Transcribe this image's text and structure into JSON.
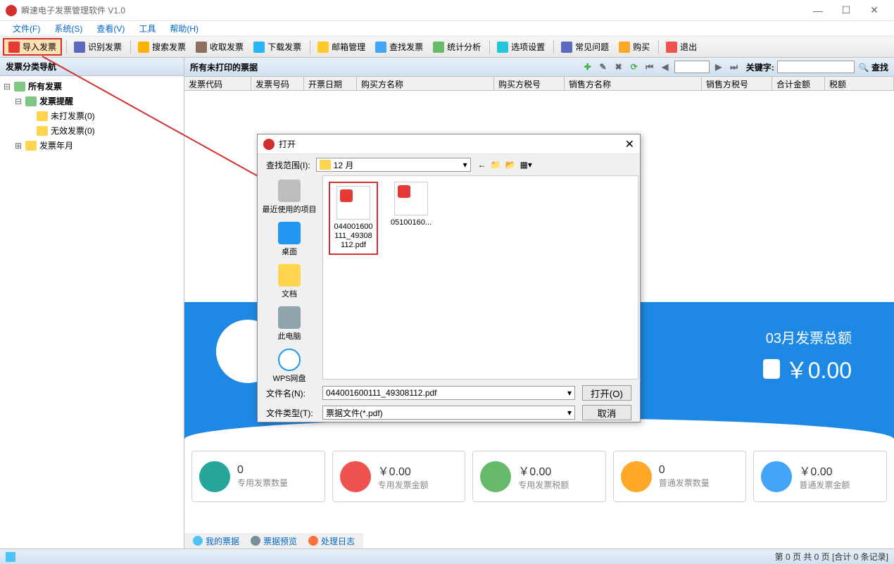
{
  "titlebar": {
    "title": "瞬速电子发票管理软件 V1.0"
  },
  "menubar": {
    "file": "文件(F)",
    "system": "系统(S)",
    "view": "查看(V)",
    "tools": "工具",
    "help": "帮助(H)"
  },
  "toolbar": {
    "import": "导入发票",
    "recognize": "识别发票",
    "search": "搜索发票",
    "receive": "收取发票",
    "download": "下载发票",
    "mailbox": "邮箱管理",
    "find": "查找发票",
    "stats": "统计分析",
    "options": "选项设置",
    "faq": "常见问题",
    "buy": "购买",
    "exit": "退出"
  },
  "sidebar": {
    "header": "发票分类导航",
    "nodes": {
      "all": "所有发票",
      "remind": "发票提醒",
      "unprinted": "未打发票(0)",
      "invalid": "无效发票(0)",
      "byyear": "发票年月"
    }
  },
  "content": {
    "header": "所有未打印的票据",
    "keyword_label": "关键字:",
    "search_btn": "查找",
    "columns": {
      "code": "发票代码",
      "number": "发票号码",
      "date": "开票日期",
      "buyer": "购买方名称",
      "buyer_tax": "购买方税号",
      "seller": "销售方名称",
      "seller_tax": "销售方税号",
      "total": "合计金额",
      "tax": "税额"
    }
  },
  "dialog": {
    "title": "打开",
    "range_label": "查找范围(I):",
    "folder": "12 月",
    "sidebar": {
      "recent": "最近使用的项目",
      "desktop": "桌面",
      "docs": "文档",
      "pc": "此电脑",
      "wps": "WPS网盘"
    },
    "files": {
      "f1": "044001600111_49308112.pdf",
      "f2": "05100160..."
    },
    "filename_label": "文件名(N):",
    "filename_value": "044001600111_49308112.pdf",
    "filetype_label": "文件类型(T):",
    "filetype_value": "票据文件(*.pdf)",
    "open_btn": "打开(O)",
    "cancel_btn": "取消"
  },
  "dashboard": {
    "month_label": "03月发票总额",
    "month_amount": "￥0.00",
    "cards": [
      {
        "value": "0",
        "label": "专用发票数量"
      },
      {
        "value": "￥0.00",
        "label": "专用发票金额"
      },
      {
        "value": "￥0.00",
        "label": "专用发票税额"
      },
      {
        "value": "0",
        "label": "普通发票数量"
      },
      {
        "value": "￥0.00",
        "label": "普通发票金额"
      }
    ]
  },
  "bottom_tabs": {
    "my": "我的票据",
    "preview": "票据预览",
    "log": "处理日志"
  },
  "statusbar": {
    "text": "第 0 页 共 0 页 [合计 0 条记录]"
  }
}
